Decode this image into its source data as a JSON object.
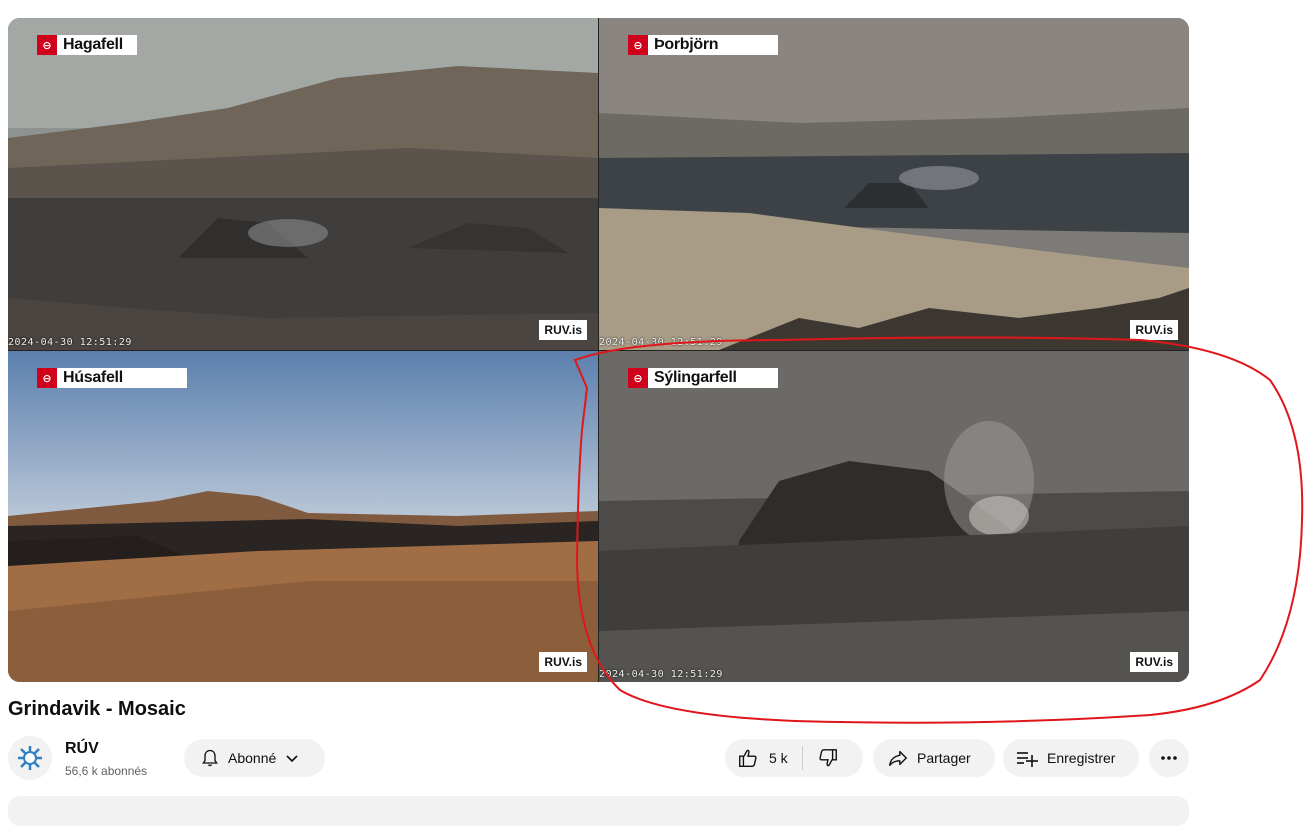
{
  "cameras": [
    {
      "name": "Hagafell",
      "timestamp": "2024-04-30 12:51:29",
      "watermark": "RUV.is"
    },
    {
      "name": "Þorbjörn",
      "timestamp": "2024-04-30 12:51:29",
      "watermark": "RUV.is"
    },
    {
      "name": "Húsafell",
      "timestamp": "",
      "watermark": "RUV.is"
    },
    {
      "name": "Sýlingarfell",
      "timestamp": "2024-04-30 12:51:29",
      "watermark": "RUV.is"
    }
  ],
  "video": {
    "title": "Grindavik - Mosaic"
  },
  "channel": {
    "name": "RÚV",
    "subscribers": "56,6 k abonnés",
    "subscribe_label": "Abonné"
  },
  "actions": {
    "likes": "5 k",
    "share_label": "Partager",
    "save_label": "Enregistrer"
  },
  "icons": {
    "bell": "bell-icon",
    "chevron": "chevron-down-icon",
    "like": "thumbs-up-icon",
    "dislike": "thumbs-down-icon",
    "share": "share-icon",
    "save": "playlist-add-icon",
    "more": "more-horiz-icon"
  },
  "colors": {
    "ruv_red": "#d0021b",
    "annotation": "#e0161b",
    "button_bg": "#f2f2f2"
  }
}
